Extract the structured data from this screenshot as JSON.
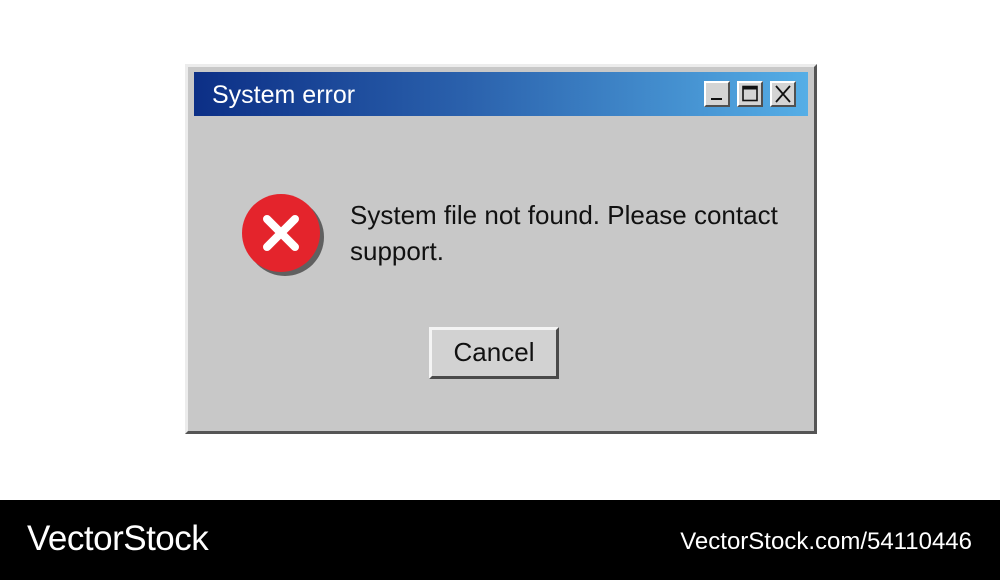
{
  "window": {
    "title": "System error",
    "controls": {
      "minimize_icon": "minimize-icon",
      "maximize_icon": "maximize-icon",
      "close_icon": "close-icon"
    }
  },
  "content": {
    "icon": "error-icon",
    "message": "System file not found. Please contact support.",
    "cancel_label": "Cancel"
  },
  "watermark": {
    "brand": "VectorStock",
    "ref": "VectorStock.com/54110446"
  },
  "colors": {
    "titlebar_start": "#0c2f86",
    "titlebar_end": "#55aee6",
    "dialog_bg": "#c8c8c8",
    "error_red": "#e4242c",
    "footer_bg": "#000000"
  }
}
